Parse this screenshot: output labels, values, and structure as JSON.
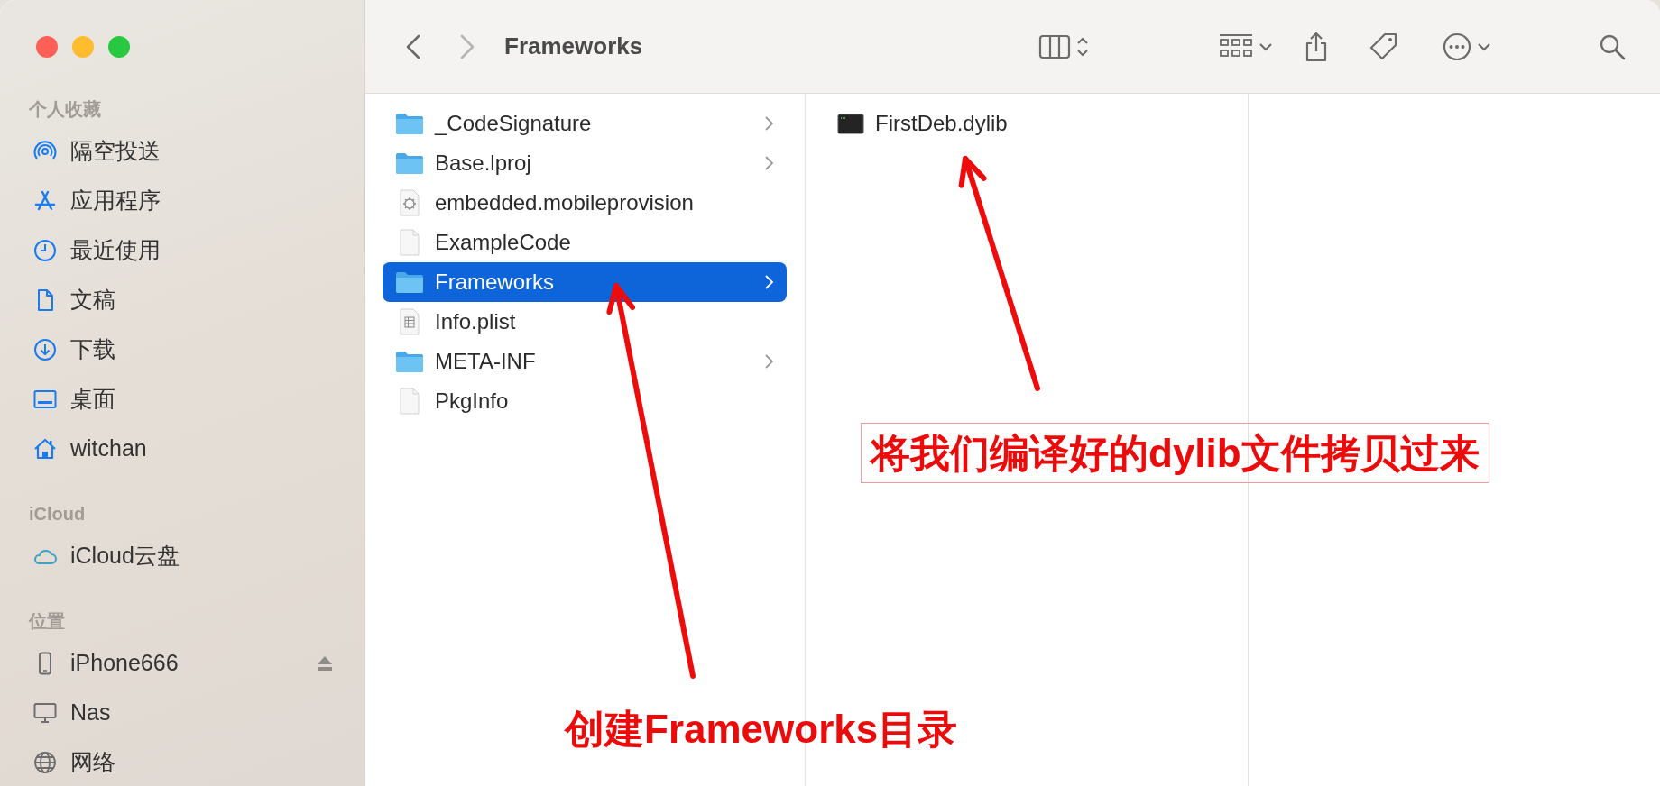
{
  "window": {
    "title": "Frameworks"
  },
  "sidebar": {
    "sections": [
      {
        "heading": "个人收藏",
        "items": [
          {
            "label": "隔空投送",
            "kind": "airdrop",
            "selected": false,
            "ejectable": false
          },
          {
            "label": "应用程序",
            "kind": "apps",
            "selected": false,
            "ejectable": false
          },
          {
            "label": "最近使用",
            "kind": "recents",
            "selected": false,
            "ejectable": false
          },
          {
            "label": "文稿",
            "kind": "documents",
            "selected": false,
            "ejectable": false
          },
          {
            "label": "下载",
            "kind": "downloads",
            "selected": false,
            "ejectable": false
          },
          {
            "label": "桌面",
            "kind": "desktop",
            "selected": false,
            "ejectable": false
          },
          {
            "label": "witchan",
            "kind": "home",
            "selected": false,
            "ejectable": false
          }
        ]
      },
      {
        "heading": "iCloud",
        "items": [
          {
            "label": "iCloud云盘",
            "kind": "icloud",
            "selected": false,
            "ejectable": false
          }
        ]
      },
      {
        "heading": "位置",
        "items": [
          {
            "label": "iPhone666",
            "kind": "iphone",
            "selected": false,
            "ejectable": true
          },
          {
            "label": "Nas",
            "kind": "computer",
            "selected": false,
            "ejectable": false
          },
          {
            "label": "网络",
            "kind": "network",
            "selected": false,
            "ejectable": false
          }
        ]
      }
    ]
  },
  "columns": [
    {
      "items": [
        {
          "name": "_CodeSignature",
          "kind": "folder",
          "selected": false
        },
        {
          "name": "Base.lproj",
          "kind": "folder",
          "selected": false
        },
        {
          "name": "embedded.mobileprovision",
          "kind": "provision",
          "selected": false
        },
        {
          "name": "ExampleCode",
          "kind": "file",
          "selected": false
        },
        {
          "name": "Frameworks",
          "kind": "folder",
          "selected": true
        },
        {
          "name": "Info.plist",
          "kind": "plist",
          "selected": false
        },
        {
          "name": "META-INF",
          "kind": "folder",
          "selected": false
        },
        {
          "name": "PkgInfo",
          "kind": "file",
          "selected": false
        }
      ]
    },
    {
      "items": [
        {
          "name": "FirstDeb.dylib",
          "kind": "exec",
          "selected": false
        }
      ]
    }
  ],
  "annotations": [
    {
      "text": "将我们编译好的dylib文件拷贝过来",
      "boxed": true
    },
    {
      "text": "创建Frameworks目录",
      "boxed": false
    }
  ]
}
